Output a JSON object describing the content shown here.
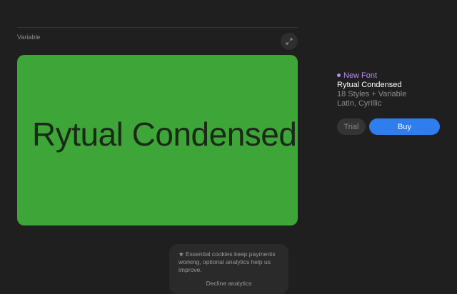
{
  "section": {
    "label": "Variable"
  },
  "preview": {
    "sample_text": "Rytual Condensed",
    "bg_color": "#3ea639"
  },
  "font_info": {
    "badge": "New Font",
    "name": "Rytual Condensed",
    "styles": "18 Styles + Variable",
    "scripts": "Latin, Cyrillic",
    "accent_color": "#b58cf0"
  },
  "actions": {
    "trial_label": "Trial",
    "buy_label": "Buy",
    "buy_color": "#2f7ef0"
  },
  "cookie": {
    "message": "Essential cookies keep payments working, optional analytics help us improve.",
    "decline_label": "Decline analytics"
  },
  "icons": {
    "expand": "expand-arrows-icon",
    "bullet": "star-icon"
  }
}
